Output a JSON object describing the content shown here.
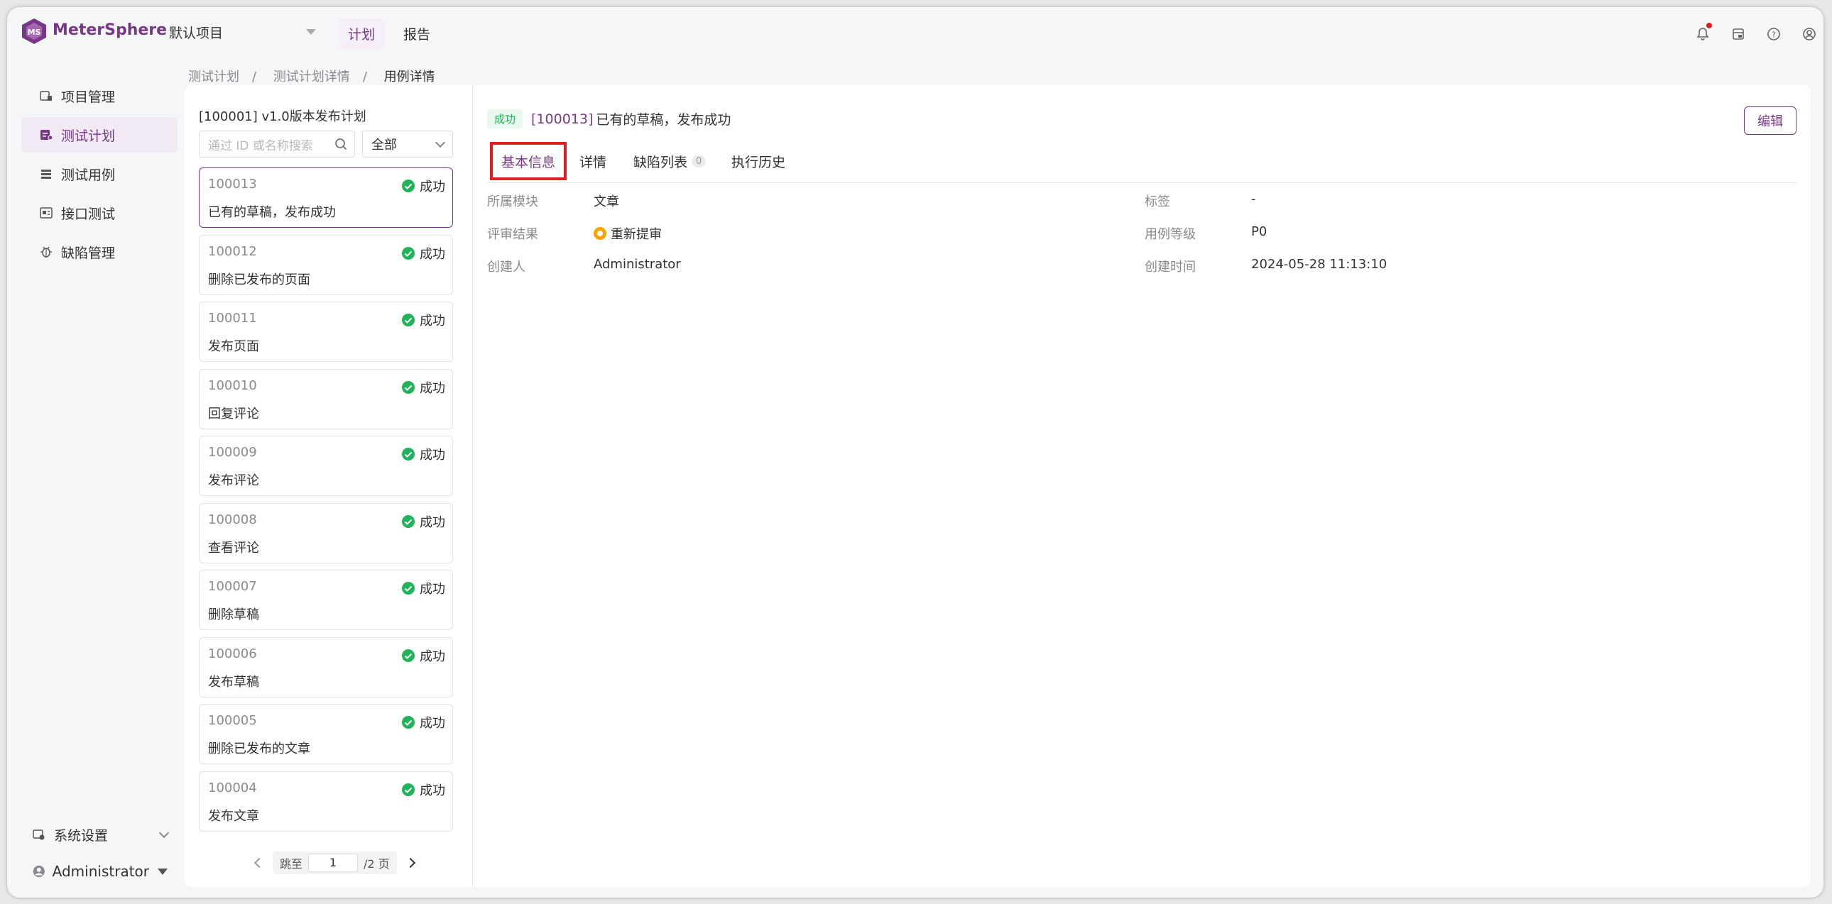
{
  "brand": "MeterSphere",
  "project": "默认项目",
  "topnav": [
    {
      "label": "计划",
      "active": true
    },
    {
      "label": "报告",
      "active": false
    }
  ],
  "breadcrumb": [
    "测试计划",
    "测试计划详情",
    "用例详情"
  ],
  "sidebar": {
    "items": [
      {
        "label": "项目管理",
        "active": false
      },
      {
        "label": "测试计划",
        "active": true
      },
      {
        "label": "测试用例",
        "active": false
      },
      {
        "label": "接口测试",
        "active": false
      },
      {
        "label": "缺陷管理",
        "active": false
      }
    ],
    "system_settings": "系统设置",
    "user": "Administrator"
  },
  "plan": {
    "title": "[100001] v1.0版本发布计划",
    "search_placeholder": "通过 ID 或名称搜索",
    "filter": "全部"
  },
  "cases": [
    {
      "id": "100013",
      "status": "成功",
      "name": "已有的草稿，发布成功"
    },
    {
      "id": "100012",
      "status": "成功",
      "name": "删除已发布的页面"
    },
    {
      "id": "100011",
      "status": "成功",
      "name": "发布页面"
    },
    {
      "id": "100010",
      "status": "成功",
      "name": "回复评论"
    },
    {
      "id": "100009",
      "status": "成功",
      "name": "发布评论"
    },
    {
      "id": "100008",
      "status": "成功",
      "name": "查看评论"
    },
    {
      "id": "100007",
      "status": "成功",
      "name": "删除草稿"
    },
    {
      "id": "100006",
      "status": "成功",
      "name": "发布草稿"
    },
    {
      "id": "100005",
      "status": "成功",
      "name": "删除已发布的文章"
    },
    {
      "id": "100004",
      "status": "成功",
      "name": "发布文章"
    }
  ],
  "pager": {
    "jump_label": "跳至",
    "page": "1",
    "total": "/2 页"
  },
  "detail": {
    "status_tag": "成功",
    "case_id": "[100013]",
    "case_title": "已有的草稿，发布成功",
    "edit_label": "编辑",
    "tabs": [
      {
        "label": "基本信息"
      },
      {
        "label": "详情"
      },
      {
        "label": "缺陷列表",
        "count": "0"
      },
      {
        "label": "执行历史"
      }
    ],
    "fields": {
      "module_label": "所属模块",
      "module_value": "文章",
      "tag_label": "标签",
      "tag_value": "-",
      "review_label": "评审结果",
      "review_value": "重新提审",
      "level_label": "用例等级",
      "level_value": "P0",
      "creator_label": "创建人",
      "creator_value": "Administrator",
      "created_label": "创建时间",
      "created_value": "2024-05-28 11:13:10"
    }
  },
  "colors": {
    "accent": "#783887",
    "success": "#20b35a",
    "warning": "#ffa200",
    "highlight": "#e02020"
  }
}
